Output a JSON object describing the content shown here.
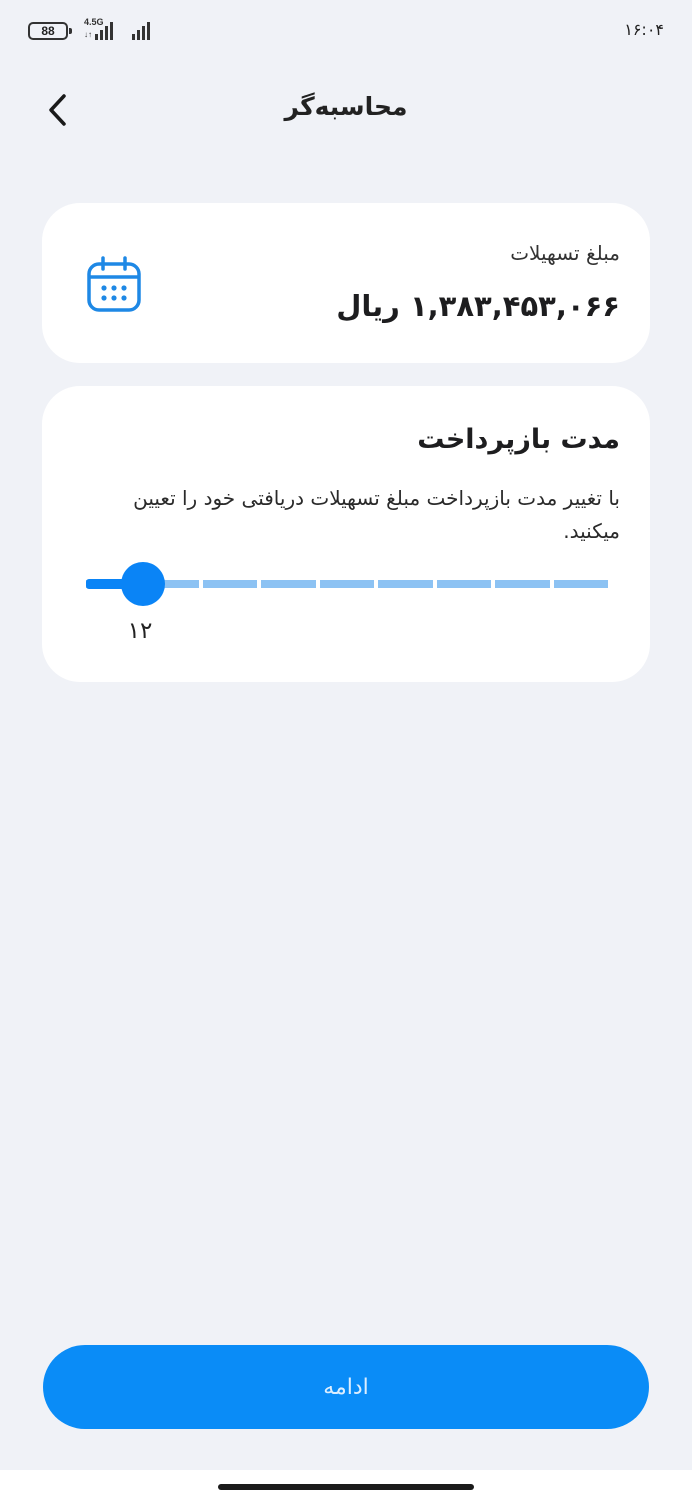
{
  "status_bar": {
    "battery": "88",
    "network_type": "4.5G",
    "network_arrows": "↓↑",
    "time": "۱۶:۰۴"
  },
  "header": {
    "title": "محاسبه‌گر",
    "back_icon": "chevron-left-icon"
  },
  "amount_card": {
    "label": "مبلغ تسهیلات",
    "value": "۱,۳۸۳,۴۵۳,۰۶۶ ریال",
    "icon": "calendar-icon"
  },
  "duration_card": {
    "title": "مدت بازپرداخت",
    "description": "با تغییر مدت بازپرداخت مبلغ تسهیلات دریافتی خود را تعیین میکنید.",
    "slider": {
      "value_label": "۱۲",
      "steps": 9,
      "selected_step": 1
    }
  },
  "footer": {
    "continue_label": "ادامه"
  },
  "colors": {
    "accent": "#0a84f6",
    "track": "#8cc2f3",
    "background": "#f0f2f7",
    "card": "#ffffff"
  }
}
